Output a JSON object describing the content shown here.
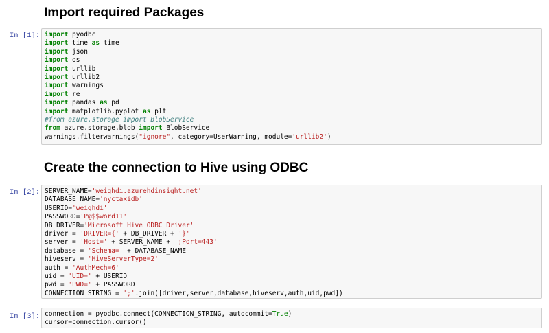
{
  "cells": [
    {
      "type": "markdown",
      "text": "Import required Packages"
    },
    {
      "type": "code",
      "prompt": "In [1]:",
      "lines": [
        [
          [
            "kw",
            "import"
          ],
          [
            "t",
            " pyodbc"
          ]
        ],
        [
          [
            "kw",
            "import"
          ],
          [
            "t",
            " time "
          ],
          [
            "kw",
            "as"
          ],
          [
            "t",
            " time"
          ]
        ],
        [
          [
            "kw",
            "import"
          ],
          [
            "t",
            " json"
          ]
        ],
        [
          [
            "kw",
            "import"
          ],
          [
            "t",
            " os"
          ]
        ],
        [
          [
            "kw",
            "import"
          ],
          [
            "t",
            " urllib"
          ]
        ],
        [
          [
            "kw",
            "import"
          ],
          [
            "t",
            " urllib2"
          ]
        ],
        [
          [
            "kw",
            "import"
          ],
          [
            "t",
            " warnings"
          ]
        ],
        [
          [
            "kw",
            "import"
          ],
          [
            "t",
            " re"
          ]
        ],
        [
          [
            "kw",
            "import"
          ],
          [
            "t",
            " pandas "
          ],
          [
            "kw",
            "as"
          ],
          [
            "t",
            " pd"
          ]
        ],
        [
          [
            "kw",
            "import"
          ],
          [
            "t",
            " matplotlib.pyplot "
          ],
          [
            "kw",
            "as"
          ],
          [
            "t",
            " plt"
          ]
        ],
        [
          [
            "cm",
            "#from azure.storage import BlobService"
          ]
        ],
        [
          [
            "kw",
            "from"
          ],
          [
            "t",
            " azure.storage.blob "
          ],
          [
            "kw",
            "import"
          ],
          [
            "t",
            " BlobService"
          ]
        ],
        [
          [
            "t",
            "warnings.filterwarnings("
          ],
          [
            "st",
            "\"ignore\""
          ],
          [
            "t",
            ", category=UserWarning, module="
          ],
          [
            "st",
            "'urllib2'"
          ],
          [
            "t",
            ")"
          ]
        ]
      ]
    },
    {
      "type": "markdown",
      "text": "Create the connection to Hive using ODBC"
    },
    {
      "type": "code",
      "prompt": "In [2]:",
      "lines": [
        [
          [
            "t",
            "SERVER_NAME="
          ],
          [
            "st",
            "'weighdi.azurehdinsight.net'"
          ]
        ],
        [
          [
            "t",
            "DATABASE_NAME="
          ],
          [
            "st",
            "'nyctaxidb'"
          ]
        ],
        [
          [
            "t",
            "USERID="
          ],
          [
            "st",
            "'weighdi'"
          ]
        ],
        [
          [
            "t",
            "PASSWORD="
          ],
          [
            "st",
            "'P@$$word11'"
          ]
        ],
        [
          [
            "t",
            "DB_DRIVER="
          ],
          [
            "st",
            "'Microsoft Hive ODBC Driver'"
          ]
        ],
        [
          [
            "t",
            "driver = "
          ],
          [
            "st",
            "'DRIVER={'"
          ],
          [
            "t",
            " + DB_DRIVER + "
          ],
          [
            "st",
            "'}'"
          ]
        ],
        [
          [
            "t",
            "server = "
          ],
          [
            "st",
            "'Host='"
          ],
          [
            "t",
            " + SERVER_NAME + "
          ],
          [
            "st",
            "';Port=443'"
          ]
        ],
        [
          [
            "t",
            "database = "
          ],
          [
            "st",
            "'Schema='"
          ],
          [
            "t",
            " + DATABASE_NAME"
          ]
        ],
        [
          [
            "t",
            "hiveserv = "
          ],
          [
            "st",
            "'HiveServerType=2'"
          ]
        ],
        [
          [
            "t",
            "auth = "
          ],
          [
            "st",
            "'AuthMech=6'"
          ]
        ],
        [
          [
            "t",
            "uid = "
          ],
          [
            "st",
            "'UID='"
          ],
          [
            "t",
            " + USERID"
          ]
        ],
        [
          [
            "t",
            "pwd = "
          ],
          [
            "st",
            "'PWD='"
          ],
          [
            "t",
            " + PASSWORD"
          ]
        ],
        [
          [
            "t",
            "CONNECTION_STRING = "
          ],
          [
            "st",
            "';'"
          ],
          [
            "t",
            ".join([driver,server,database,hiveserv,auth,uid,pwd])"
          ]
        ]
      ]
    },
    {
      "type": "code",
      "prompt": "In [3]:",
      "lines": [
        [
          [
            "t",
            "connection = pyodbc.connect(CONNECTION_STRING, autocommit="
          ],
          [
            "bi",
            "True"
          ],
          [
            "t",
            ")"
          ]
        ],
        [
          [
            "t",
            "cursor=connection.cursor()"
          ]
        ]
      ]
    }
  ]
}
